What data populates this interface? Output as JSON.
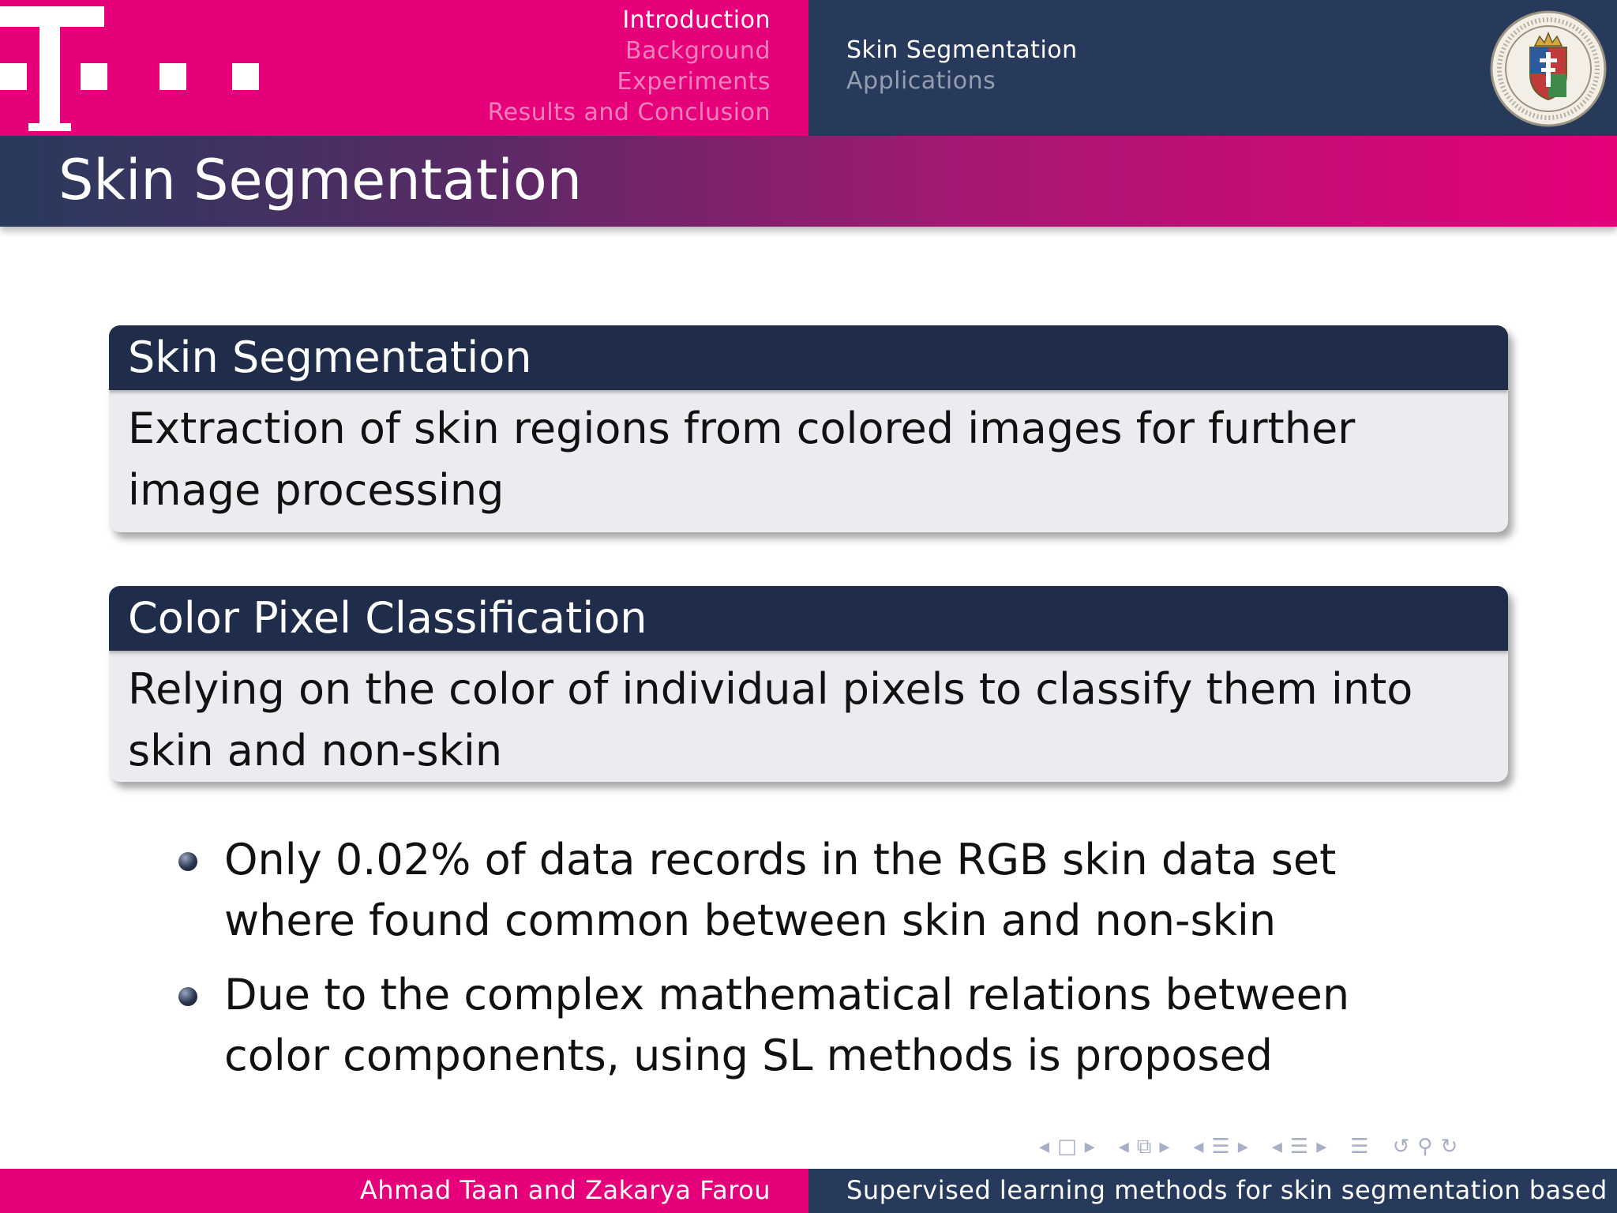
{
  "header": {
    "sections": [
      {
        "label": "Introduction",
        "active": true
      },
      {
        "label": "Background",
        "active": false
      },
      {
        "label": "Experiments",
        "active": false
      },
      {
        "label": "Results and Conclusion",
        "active": false
      }
    ],
    "subsections": [
      {
        "label": "Skin Segmentation",
        "active": true
      },
      {
        "label": "Applications",
        "active": false
      }
    ],
    "logo_icon": "t-logo-icon",
    "seal_icon": "university-seal-icon"
  },
  "frame": {
    "title": "Skin Segmentation"
  },
  "blocks": [
    {
      "title": "Skin Segmentation",
      "body": "Extraction of skin regions from colored images for further image processing"
    },
    {
      "title": "Color Pixel Classification",
      "body": "Relying on the color of individual pixels to classify them into skin and non-skin"
    }
  ],
  "bullets": [
    "Only 0.02% of data records in the RGB skin data set where found common between skin and non-skin",
    "Due to the complex mathematical relations between color components, using SL methods is proposed"
  ],
  "footer": {
    "authors": "Ahmad Taan and Zakarya Farou",
    "title": "Supervised learning methods for skin segmentation based o"
  },
  "colors": {
    "magenta": "#e6007a",
    "navy": "#283a5c",
    "block_title": "#1f2d4a",
    "block_body": "#ebebf0"
  }
}
